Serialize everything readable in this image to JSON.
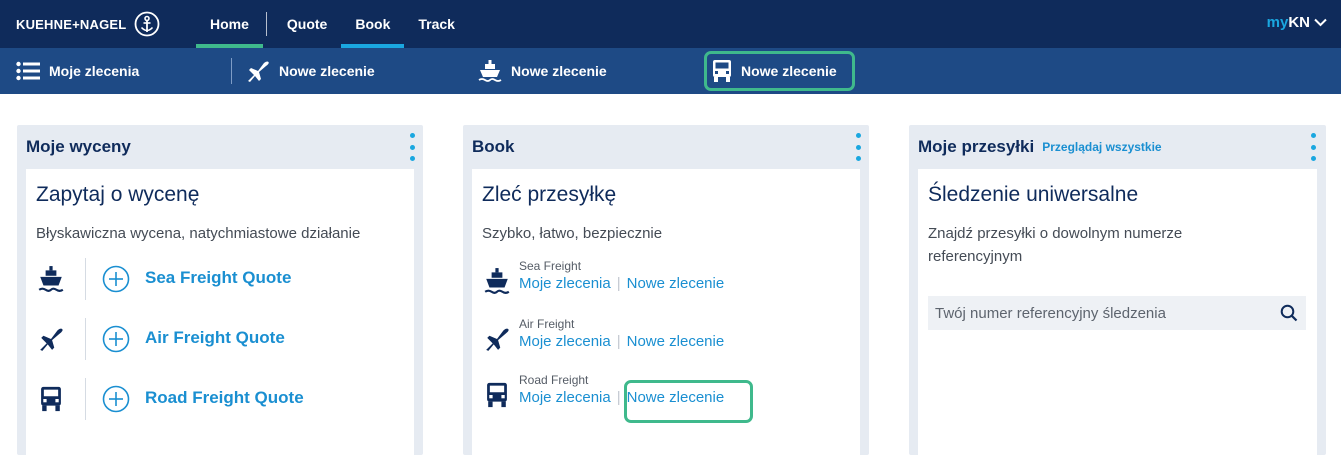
{
  "colors": {
    "nav_bg": "#0f2b5b",
    "subnav_bg": "#1e4a85",
    "accent_blue": "#1aa7e0",
    "link_blue": "#1a8fd1",
    "highlight_green": "#3fb98c",
    "home_underline": "#3fb98c",
    "book_underline": "#1aa7e0",
    "card_bg": "#e6ebf2"
  },
  "topbar": {
    "logo_text": "KUEHNE+NAGEL",
    "logo_icon": "anchor-icon",
    "tabs": [
      {
        "label": "Home",
        "active_indicator": "green"
      },
      {
        "label": "Quote",
        "active_indicator": "none"
      },
      {
        "label": "Book",
        "active_indicator": "blue"
      },
      {
        "label": "Track",
        "active_indicator": "none"
      }
    ],
    "mykn_prefix": "my",
    "mykn_suffix": "KN",
    "mykn_icon": "chevron-down-icon"
  },
  "subnav": {
    "items": [
      {
        "label": "Moje zlecenia",
        "icon": "list-icon"
      },
      {
        "label": "Nowe zlecenie",
        "icon": "airplane-icon"
      },
      {
        "label": "Nowe zlecenie",
        "icon": "ship-icon"
      },
      {
        "label": "Nowe zlecenie",
        "icon": "truck-icon",
        "highlighted": true
      }
    ]
  },
  "cards": {
    "quotes": {
      "header": "Moje wyceny",
      "title": "Zapytaj o wycenę",
      "subtitle": "Błyskawiczna wycena, natychmiastowe działanie",
      "rows": [
        {
          "icon": "ship-icon",
          "label": "Sea Freight Quote"
        },
        {
          "icon": "airplane-icon",
          "label": "Air Freight Quote"
        },
        {
          "icon": "truck-icon",
          "label": "Road Freight Quote"
        }
      ]
    },
    "book": {
      "header": "Book",
      "title": "Zleć przesyłkę",
      "subtitle": "Szybko, łatwo, bezpiecznie",
      "rows": [
        {
          "icon": "ship-icon",
          "caption": "Sea Freight",
          "link1": "Moje zlecenia",
          "separator": "|",
          "link2": "Nowe zlecenie"
        },
        {
          "icon": "airplane-icon",
          "caption": "Air Freight",
          "link1": "Moje zlecenia",
          "separator": "|",
          "link2": "Nowe zlecenie"
        },
        {
          "icon": "truck-icon",
          "caption": "Road Freight",
          "link1": "Moje zlecenia",
          "separator": "|",
          "link2": "Nowe zlecenie",
          "highlighted": true
        }
      ]
    },
    "shipments": {
      "header": "Moje przesyłki",
      "header_link": "Przeglądaj wszystkie",
      "title": "Śledzenie uniwersalne",
      "subtitle": "Znajdź przesyłki o dowolnym numerze referencyjnym",
      "search_placeholder": "Twój numer referencyjny śledzenia",
      "search_icon": "search-icon"
    }
  }
}
